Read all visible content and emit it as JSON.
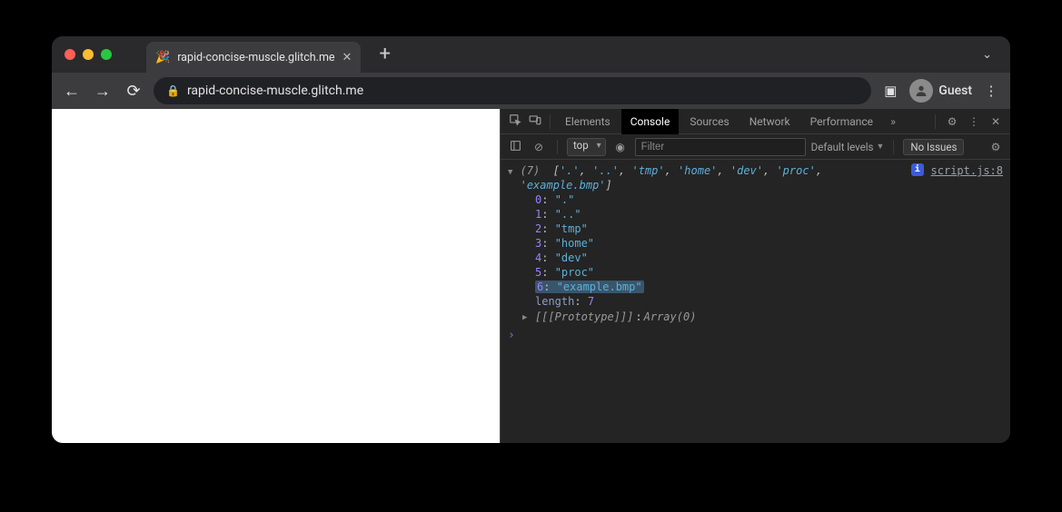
{
  "tab": {
    "favicon": "🎉",
    "title": "rapid-concise-muscle.glitch.me"
  },
  "url_display": "rapid-concise-muscle.glitch.me",
  "profile_label": "Guest",
  "devtools": {
    "tabs": {
      "elements": "Elements",
      "console": "Console",
      "sources": "Sources",
      "network": "Network",
      "performance": "Performance"
    },
    "context": "top",
    "filter_placeholder": "Filter",
    "levels_label": "Default levels",
    "issues_label": "No Issues",
    "source_link": "script.js:8"
  },
  "console": {
    "summary_prefix": "(7)",
    "summary_items": [
      ".",
      "..",
      "tmp",
      "home",
      "dev",
      "proc",
      "example.bmp"
    ],
    "entries": [
      {
        "index": "0",
        "value": "\".\""
      },
      {
        "index": "1",
        "value": "\"..\""
      },
      {
        "index": "2",
        "value": "\"tmp\""
      },
      {
        "index": "3",
        "value": "\"home\""
      },
      {
        "index": "4",
        "value": "\"dev\""
      },
      {
        "index": "5",
        "value": "\"proc\""
      },
      {
        "index": "6",
        "value": "\"example.bmp\"",
        "highlight": true
      }
    ],
    "length_label": "length",
    "length_value": "7",
    "prototype_label": "[[Prototype]]",
    "prototype_value": "Array(0)"
  }
}
